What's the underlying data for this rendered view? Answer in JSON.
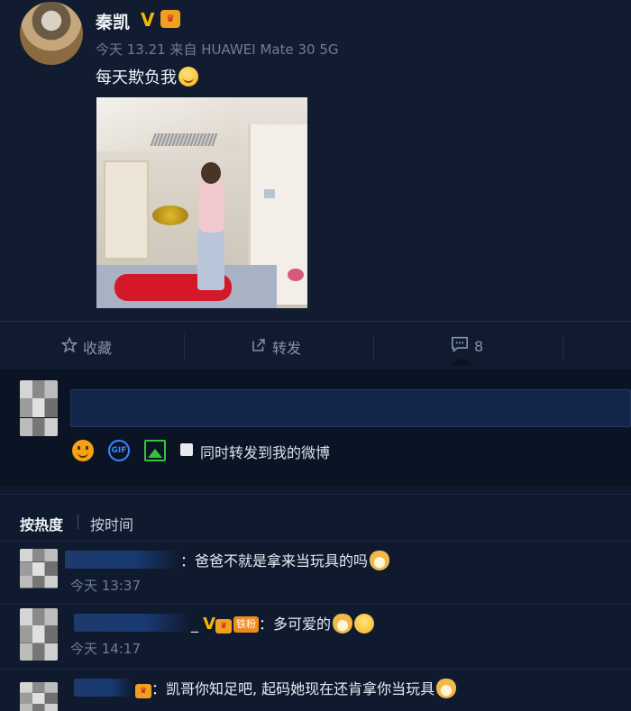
{
  "post": {
    "username": "秦凯",
    "verified_mark": "V",
    "meta": "今天 13.21 来自 HUAWEI Mate 30 5G",
    "text": "每天欺负我",
    "photo_description_icon": "photo"
  },
  "actions": {
    "favorite_label": "收藏",
    "repost_label": "转发",
    "comment_count": "8"
  },
  "compose": {
    "input_value": "",
    "repost_checkbox_label": "同时转发到我的微博",
    "gif_label": "GIF"
  },
  "sort": {
    "hot_label": "按热度",
    "time_label": "按时间"
  },
  "comments": [
    {
      "text": "：爸爸不就是拿来当玩具的吗",
      "time": "今天 13:37"
    },
    {
      "name_suffix": "_",
      "verified_mark": "V",
      "fan_badge": "铁粉",
      "text": "：多可爱的",
      "time": "今天 14:17"
    },
    {
      "text": "：凯哥你知足吧, 起码她现在还肯拿你当玩具"
    }
  ],
  "colors": {
    "background": "#0f1a2e",
    "accent_blue": "#3a87ff",
    "verified_gold": "#f5b700",
    "fan_orange": "#f08a1c"
  }
}
